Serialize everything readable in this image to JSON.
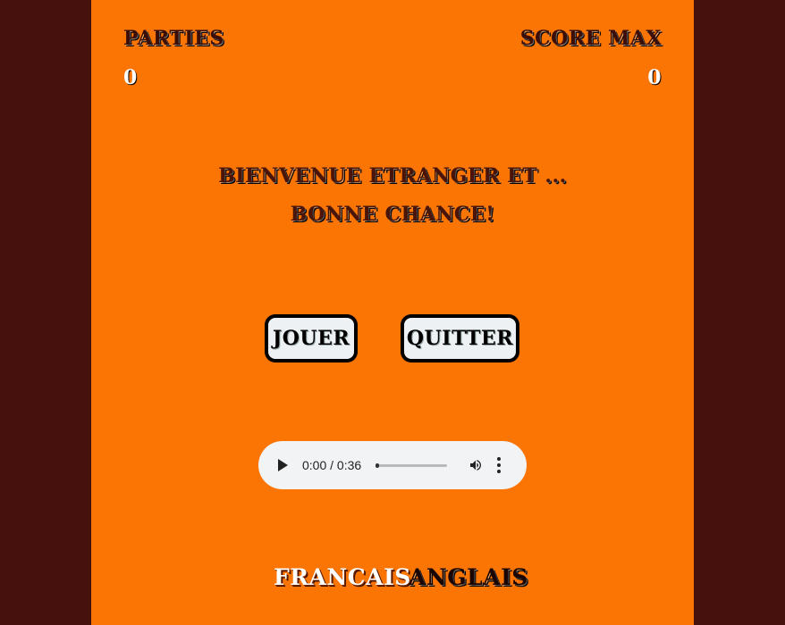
{
  "stats": {
    "parties_label": "PARTIES",
    "parties_value": "0",
    "score_label": "SCORE MAX",
    "score_value": "0"
  },
  "welcome": {
    "line1": "BIENVENUE ETRANGER ET ...",
    "line2": "BONNE CHANCE!"
  },
  "buttons": {
    "play": "JOUER",
    "quit": "QUITTER"
  },
  "audio": {
    "time": "0:00 / 0:36",
    "progress_fraction": 0.0,
    "icons": [
      "play-icon",
      "volume-icon",
      "more-vert-icon"
    ]
  },
  "languages": {
    "fr": "FRANCAIS",
    "en": "ANGLAIS"
  },
  "colors": {
    "background": "#46110d",
    "panel": "#fb7505",
    "button_bg": "#eef1f4",
    "audio_bg": "#f1f3f4"
  }
}
